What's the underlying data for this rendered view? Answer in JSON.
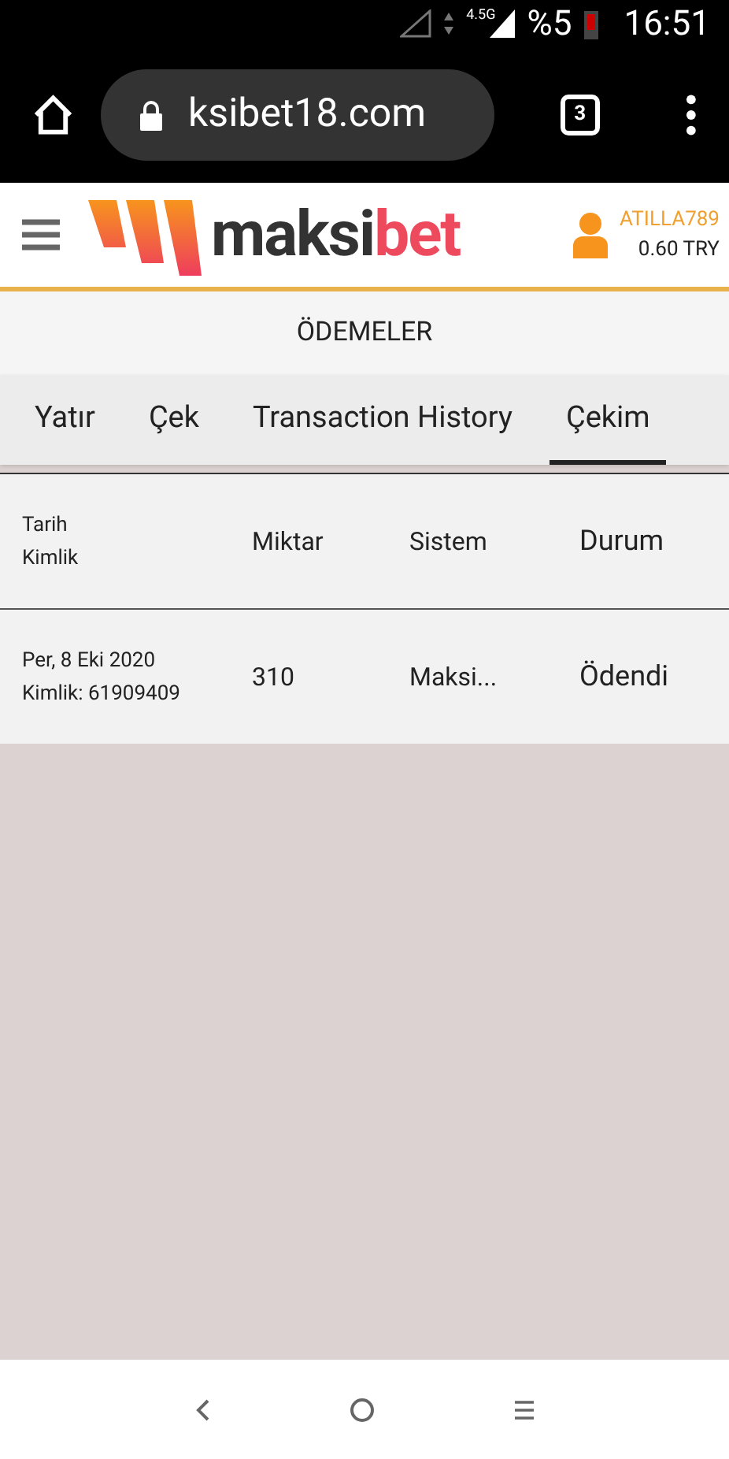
{
  "status_bar": {
    "network": "4.5G",
    "battery": "%5",
    "time": "16:51"
  },
  "browser": {
    "url": "ksibet18.com",
    "tab_count": "3"
  },
  "header": {
    "logo": {
      "dark": "maksi",
      "accent": "bet"
    },
    "username": "ATILLA789",
    "balance": "0.60 TRY"
  },
  "page_title": "ÖDEMELER",
  "tabs": [
    {
      "label": "Yatır",
      "selected": false
    },
    {
      "label": "Çek",
      "selected": false
    },
    {
      "label": "Transaction History",
      "selected": false
    },
    {
      "label": "Çekim",
      "selected": true
    }
  ],
  "table": {
    "columns": [
      {
        "lines": [
          "Tarih",
          "Kimlik"
        ]
      },
      {
        "lines": [
          "Miktar"
        ]
      },
      {
        "lines": [
          "Sistem"
        ]
      },
      {
        "lines": [
          "Durum"
        ]
      }
    ],
    "rows": [
      {
        "cells": [
          [
            "Per, 8 Eki 2020",
            "Kimlik: 61909409"
          ],
          [
            "310"
          ],
          [
            "Maksi..."
          ],
          [
            "Ödendi"
          ]
        ]
      }
    ]
  }
}
